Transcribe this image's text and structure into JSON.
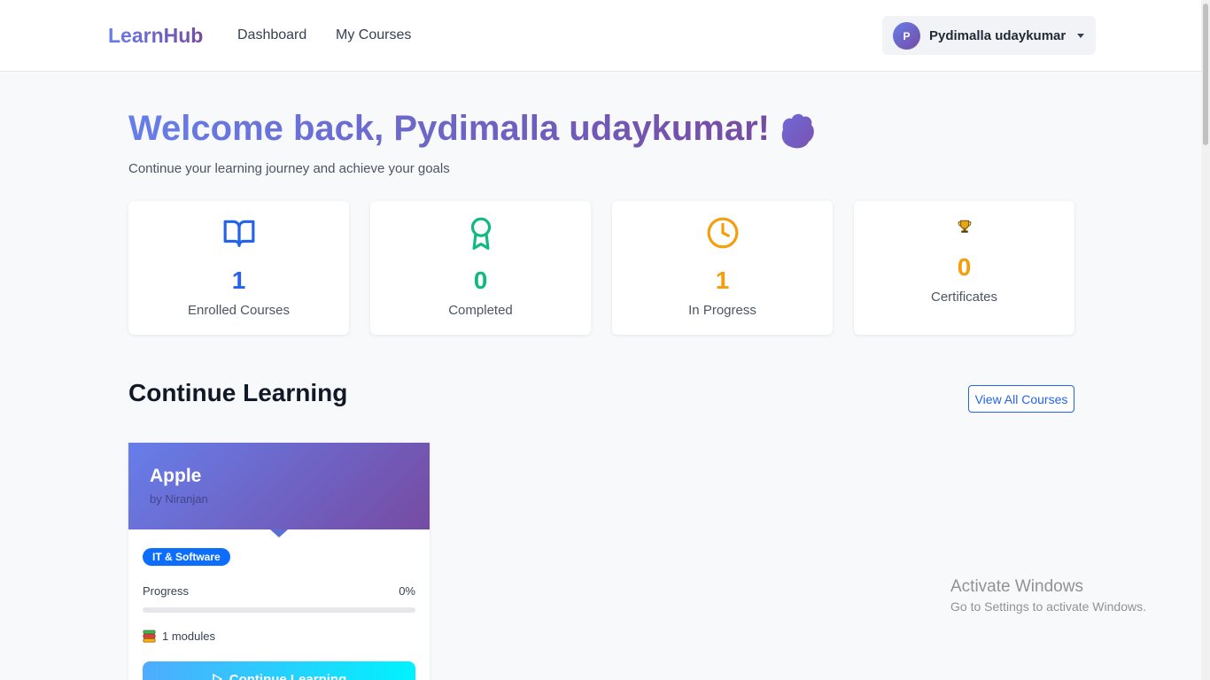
{
  "navbar": {
    "brand": "LearnHub",
    "links": [
      "Dashboard",
      "My Courses"
    ],
    "user": {
      "initial": "P",
      "name": "Pydimalla udaykumar"
    }
  },
  "welcome": {
    "title": "Welcome back, Pydimalla udaykumar!",
    "subtitle": "Continue your learning journey and achieve your goals",
    "icon": "waving-hand-icon"
  },
  "stats": [
    {
      "value": "1",
      "label": "Enrolled Courses",
      "icon": "book-open-icon",
      "color": "#2563eb"
    },
    {
      "value": "0",
      "label": "Completed",
      "icon": "award-icon",
      "color": "#10b981"
    },
    {
      "value": "1",
      "label": "In Progress",
      "icon": "clock-icon",
      "color": "#f59e0b"
    },
    {
      "value": "0",
      "label": "Certificates",
      "icon": "trophy-icon",
      "color": "#f59e0b"
    }
  ],
  "section": {
    "title": "Continue Learning",
    "view_all": "View All Courses"
  },
  "course": {
    "title": "Apple",
    "author": "by Niranjan",
    "category": "IT & Software",
    "progress_label": "Progress",
    "progress_text": "0%",
    "progress_fraction": 0,
    "modules": "1 modules",
    "button": "Continue Learning"
  },
  "watermark": {
    "title": "Activate Windows",
    "subtitle": "Go to Settings to activate Windows."
  }
}
